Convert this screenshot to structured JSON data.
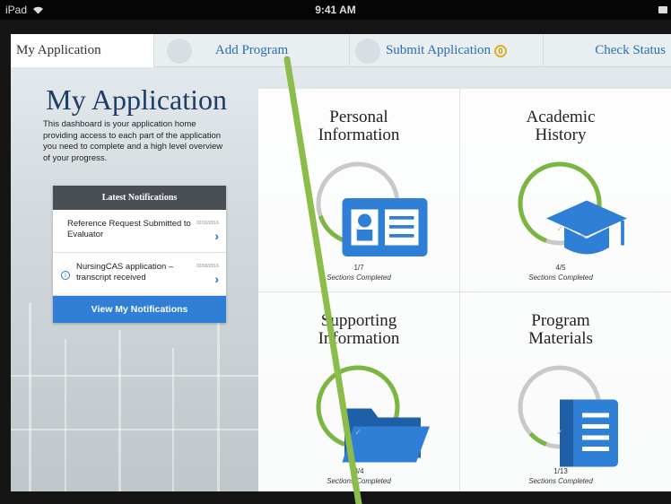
{
  "statusbar": {
    "device": "iPad",
    "time": "9:41 AM"
  },
  "tabs": [
    {
      "label": "My Application"
    },
    {
      "label": "Add Program"
    },
    {
      "label": "Submit Application",
      "badge": "0"
    },
    {
      "label": "Check Status"
    }
  ],
  "main": {
    "title": "My Application",
    "description": "This dashboard is your application home providing access to each part of the application you need to complete and a high level overview of your progress."
  },
  "notifications": {
    "header": "Latest Notifications",
    "items": [
      {
        "text": "Reference Request Submitted to Evaluator",
        "date": "02/10/2016"
      },
      {
        "text": "NursingCAS application – transcript received",
        "date": "02/09/2016"
      }
    ],
    "button": "View My Notifications"
  },
  "sections": [
    {
      "title_line1": "Personal",
      "title_line2": "Information",
      "progress": "1/7",
      "fraction_value": 0.143,
      "caption": "Sections Completed",
      "icon": "id-card-icon"
    },
    {
      "title_line1": "Academic",
      "title_line2": "History",
      "progress": "4/5",
      "fraction_value": 0.8,
      "caption": "Sections Completed",
      "icon": "graduation-cap-icon"
    },
    {
      "title_line1": "Supporting",
      "title_line2": "Information",
      "progress": "3/4",
      "fraction_value": 0.75,
      "caption": "Sections Completed",
      "icon": "folder-icon"
    },
    {
      "title_line1": "Program",
      "title_line2": "Materials",
      "progress": "1/13",
      "fraction_value": 0.077,
      "caption": "Sections Completed",
      "icon": "book-icon"
    }
  ],
  "check_mark": "✓",
  "colors": {
    "accent": "#2f7fd6",
    "progress": "#7ab640",
    "track": "#c9c9c9",
    "title": "#1e3c68",
    "badge": "#e0b120"
  }
}
